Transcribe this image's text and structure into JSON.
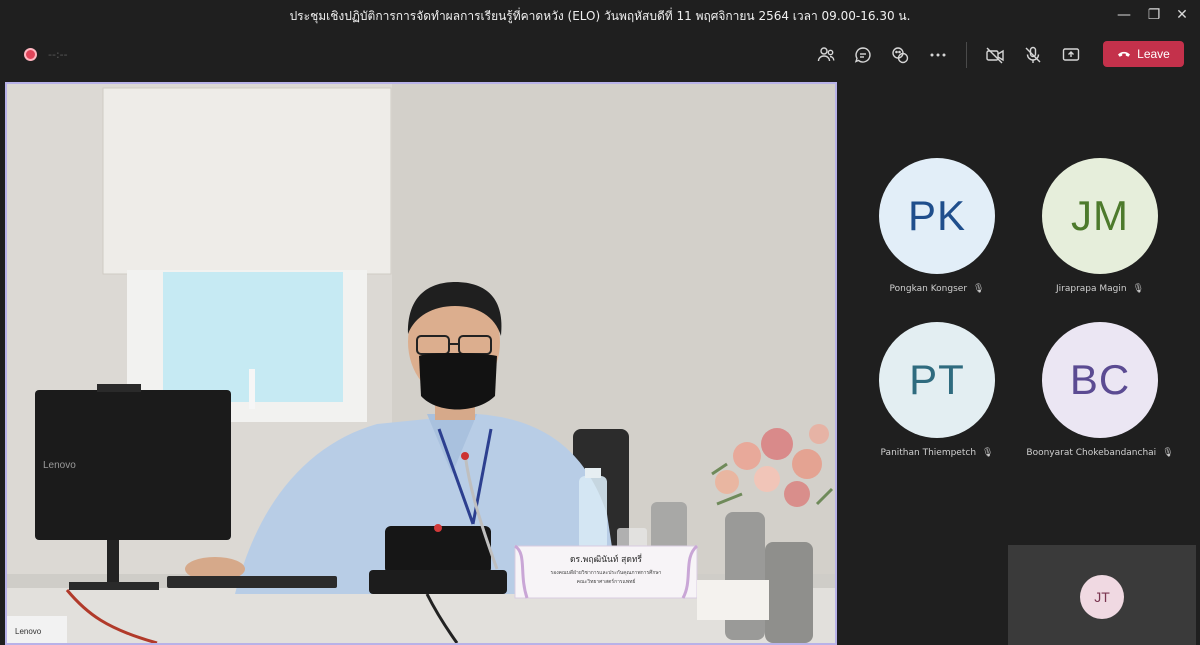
{
  "window": {
    "title": "ประชุมเชิงปฏิบัติการการจัดทำผลการเรียนรู้ที่คาดหวัง (ELO) วันพฤหัสบดีที่ 11 พฤศจิกายน 2564 เวลา 09.00-16.30 น.",
    "minimize": "—",
    "restore": "❐",
    "close": "✕"
  },
  "toolbar": {
    "timer": "--:--",
    "leave_label": "Leave",
    "icons": [
      "people-icon",
      "chat-icon",
      "reactions-icon",
      "more-icon",
      "camera-off-icon",
      "mic-off-icon",
      "share-icon"
    ]
  },
  "stage": {
    "nameplate_line1": "ดร.พฤฒินันท์  สุดทรี่",
    "nameplate_line2": "รองคณบดีฝ่ายวิชาการและประกันคุณภาพการศึกษา",
    "nameplate_line3": "คณะวิทยาศาสตร์การแพทย์",
    "monitor_brand": "Lenovo",
    "laptop_brand": "Lenovo"
  },
  "participants": [
    {
      "initials": "PK",
      "name": "Pongkan Kongser",
      "bg": "#e2eef8",
      "fg": "#1f4e8c"
    },
    {
      "initials": "JM",
      "name": "Jiraprapa Magin",
      "bg": "#e6eedb",
      "fg": "#4d7a2c"
    },
    {
      "initials": "PT",
      "name": "Panithan Thiempetch",
      "bg": "#e3eef2",
      "fg": "#2f6b7f"
    },
    {
      "initials": "BC",
      "name": "Boonyarat Chokebandanchai",
      "bg": "#ebe6f3",
      "fg": "#5b4b92"
    }
  ],
  "self": {
    "initials": "JT"
  },
  "colors": {
    "accent": "#b8b2e8",
    "leave": "#c4314b",
    "recording": "#e0455a"
  }
}
